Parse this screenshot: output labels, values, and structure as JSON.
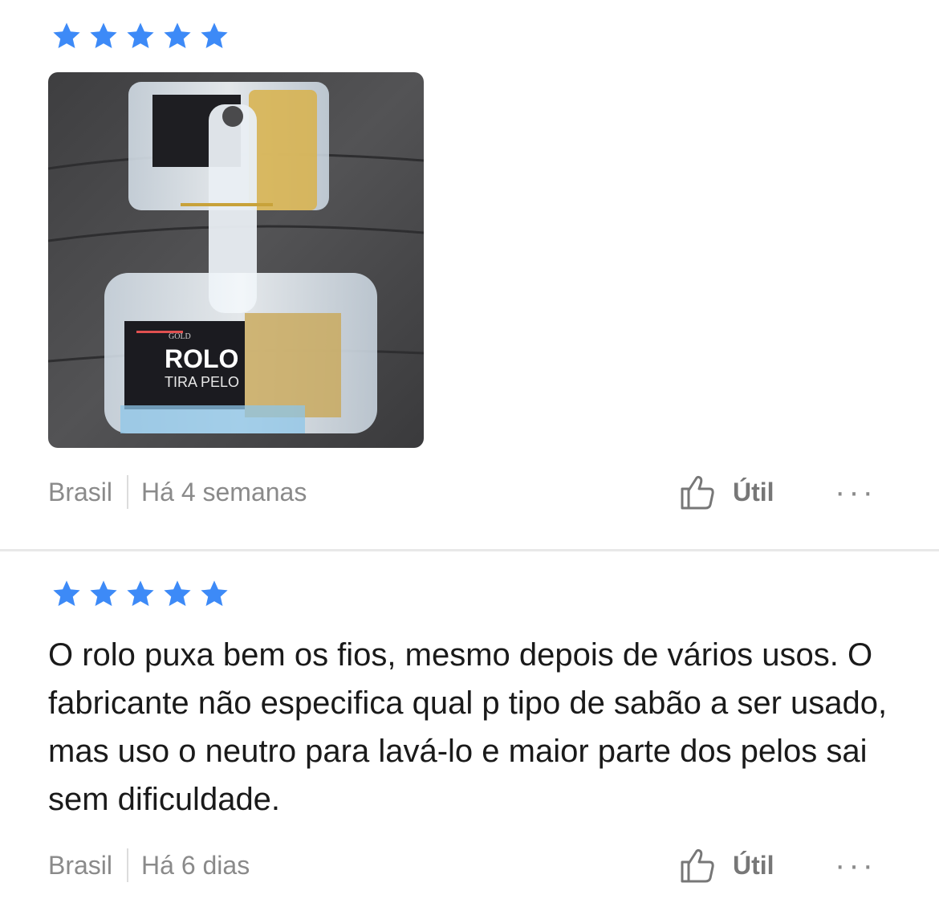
{
  "reviews": [
    {
      "rating": 5,
      "image": {
        "label_brand": "GOLD",
        "label_title": "ROLO",
        "label_subtitle": "TIRA PELO"
      },
      "country": "Brasil",
      "date": "Há 4 semanas",
      "helpful_label": "Útil",
      "more_label": "···"
    },
    {
      "rating": 5,
      "text": "O rolo puxa bem os fios, mesmo depois de vários usos. O fabricante não especifica qual p tipo de sabão a ser usado, mas uso o neutro para lavá-lo e maior parte dos pelos sai sem dificuldade.",
      "country": "Brasil",
      "date": "Há 6 dias",
      "helpful_label": "Útil",
      "more_label": "···"
    }
  ],
  "colors": {
    "star": "#3d8af7",
    "meta_text": "#8a8a8a",
    "separator": "#e8e8e8",
    "body_text": "#1a1a1a"
  },
  "icons": [
    "star-icon",
    "thumbs-up-icon",
    "more-options-icon"
  ]
}
